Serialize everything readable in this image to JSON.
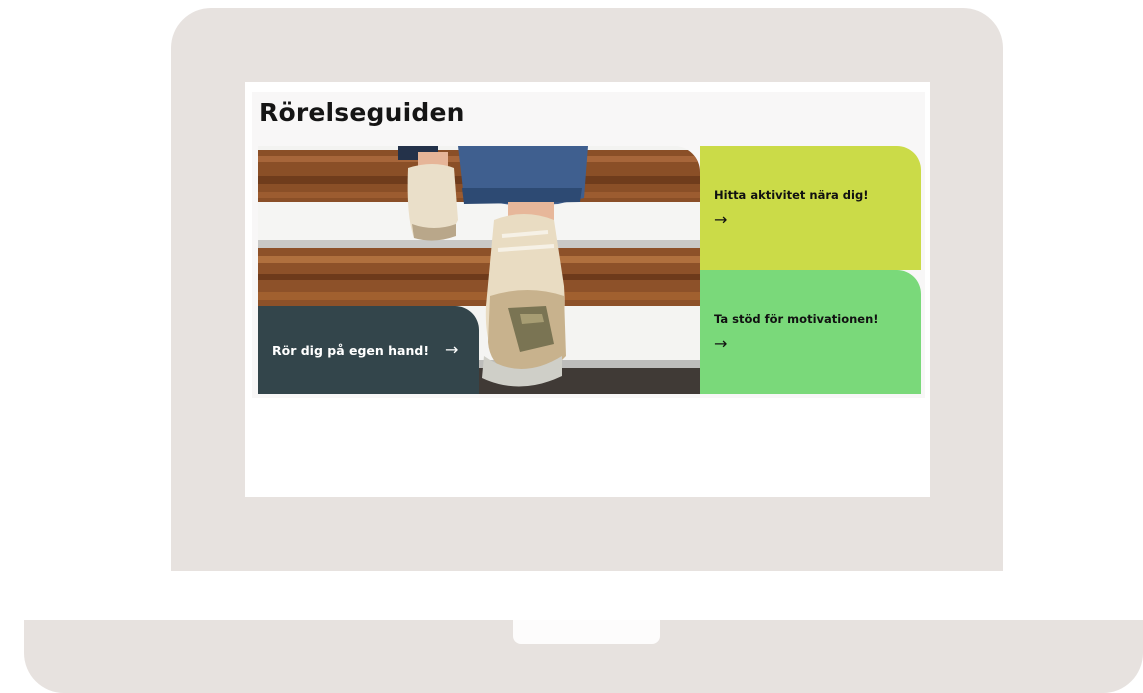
{
  "page": {
    "title": "Rörelseguiden"
  },
  "hero_image": {
    "description_icon": "stairs-sneakers-photo"
  },
  "tiles": [
    {
      "label": "Rör dig på egen hand!",
      "icon": "arrow-right-icon",
      "arrow": "→",
      "color": "#33454b"
    },
    {
      "label": "Hitta aktivitet nära dig!",
      "icon": "arrow-right-icon",
      "arrow": "→",
      "color": "#cbdb48"
    },
    {
      "label": "Ta stöd för motivationen!",
      "icon": "arrow-right-icon",
      "arrow": "→",
      "color": "#7ad97a"
    }
  ],
  "colors": {
    "device": "#e7e2df",
    "screen": "#ffffff"
  }
}
